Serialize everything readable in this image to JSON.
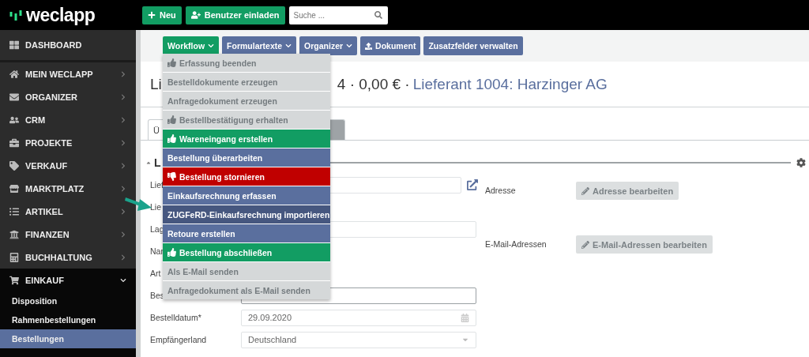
{
  "topbar": {
    "logo": "weclapp",
    "buttons": [
      {
        "label": "Neu",
        "kind": "new"
      },
      {
        "label": "Benutzer einladen",
        "kind": "invite"
      }
    ],
    "search": {
      "placeholder": "Suche ..."
    }
  },
  "sidebar": {
    "items": [
      {
        "label": "DASHBOARD",
        "kind": "link"
      },
      {
        "label": "MEIN WECLAPP",
        "kind": "group",
        "expanded": false
      },
      {
        "label": "ORGANIZER",
        "kind": "group",
        "expanded": false
      },
      {
        "label": "CRM",
        "kind": "group",
        "expanded": false
      },
      {
        "label": "PROJEKTE",
        "kind": "group",
        "expanded": false
      },
      {
        "label": "VERKAUF",
        "kind": "group",
        "expanded": false
      },
      {
        "label": "MARKTPLATZ",
        "kind": "group",
        "expanded": false
      },
      {
        "label": "ARTIKEL",
        "kind": "group",
        "expanded": false
      },
      {
        "label": "FINANZEN",
        "kind": "group",
        "expanded": false
      },
      {
        "label": "BUCHHALTUNG",
        "kind": "group",
        "expanded": false
      },
      {
        "label": "EINKAUF",
        "kind": "group",
        "expanded": true,
        "children": [
          {
            "label": "Disposition",
            "selected": false
          },
          {
            "label": "Rahmenbestellungen",
            "selected": false
          },
          {
            "label": "Bestellungen",
            "selected": true
          }
        ]
      }
    ]
  },
  "toolbar": [
    {
      "label": "Workflow",
      "kind": "success",
      "caret": true,
      "icon": false
    },
    {
      "label": "Formulartexte",
      "kind": "primary",
      "caret": true,
      "icon": false
    },
    {
      "label": "Organizer",
      "kind": "primary",
      "caret": true,
      "icon": false
    },
    {
      "label": "Dokument",
      "kind": "primary",
      "caret": false,
      "icon": true
    },
    {
      "label": "Zusatzfelder verwalten",
      "kind": "primary",
      "caret": false,
      "icon": false
    }
  ],
  "workflow_menu": [
    {
      "label": "Erfassung beenden",
      "kind": "disabled",
      "has_icon": true,
      "selected": false
    },
    {
      "label": "Bestelldokumente erzeugen",
      "kind": "disabled",
      "has_icon": false,
      "selected": false
    },
    {
      "label": "Anfragedokument erzeugen",
      "kind": "disabled",
      "has_icon": false,
      "selected": false
    },
    {
      "label": "Bestellbestätigung erhalten",
      "kind": "disabled",
      "has_icon": true,
      "selected": false
    },
    {
      "label": "Wareneingang erstellen",
      "kind": "success",
      "has_icon": true,
      "selected": false
    },
    {
      "label": "Bestellung überarbeiten",
      "kind": "primary",
      "has_icon": false,
      "selected": false
    },
    {
      "label": "Bestellung stornieren",
      "kind": "danger",
      "has_icon": true,
      "selected": false
    },
    {
      "label": "Einkaufsrechnung erfassen",
      "kind": "primary",
      "has_icon": false,
      "selected": false
    },
    {
      "label": "ZUGFeRD-Einkaufsrechnung importieren",
      "kind": "primary",
      "has_icon": false,
      "selected": true
    },
    {
      "label": "Retoure erstellen",
      "kind": "primary",
      "has_icon": false,
      "selected": false
    },
    {
      "label": "Bestellung abschließen",
      "kind": "success",
      "has_icon": true,
      "selected": false
    },
    {
      "label": "Als E-Mail senden",
      "kind": "disabled",
      "has_icon": false,
      "selected": false
    },
    {
      "label": "Anfragedokument als E-Mail senden",
      "kind": "disabled",
      "has_icon": false,
      "selected": false
    }
  ],
  "title": {
    "start": "Li",
    "amount": "4 · 0,00 € ·",
    "supplier_link": "Lieferant 1004: Harzinger AG"
  },
  "tabs": [
    {
      "label": "Ü",
      "selected": true
    },
    {
      "selected": false
    }
  ],
  "section": {
    "title": "L"
  },
  "form": [
    {
      "label": "Lief",
      "kind": "input",
      "link_icon": true
    },
    {
      "label": "Lie",
      "kind": "none"
    },
    {
      "label": "Lag",
      "kind": "input",
      "link_icon": false
    },
    {
      "label": "Nar",
      "kind": "none"
    },
    {
      "label": "Art",
      "kind": "none"
    },
    {
      "label": "Bes",
      "kind": "input",
      "link_icon": false
    },
    {
      "label": "Bestelldatum*",
      "kind": "date",
      "value": "29.09.2020"
    },
    {
      "label": "Empfängerland",
      "kind": "select",
      "value": "Deutschland"
    }
  ],
  "contact": [
    {
      "label": "Adresse",
      "button": "Adresse bearbeiten"
    },
    {
      "label": "E-Mail-Adressen",
      "button": "E-Mail-Adressen bearbeiten"
    }
  ]
}
